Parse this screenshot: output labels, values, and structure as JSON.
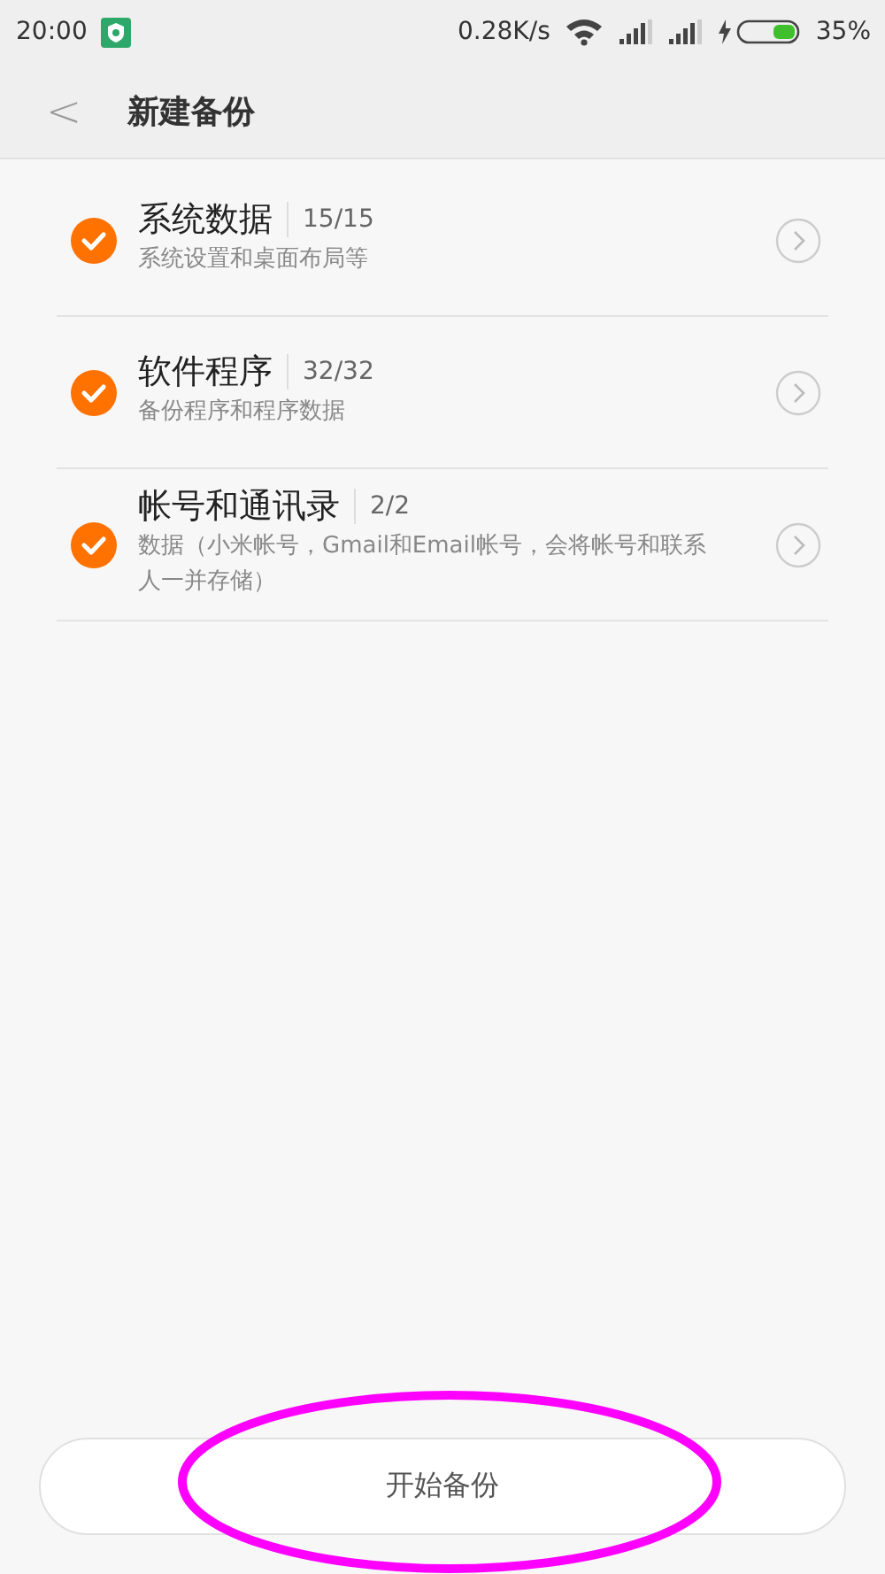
{
  "status_bar": {
    "time": "20:00",
    "speed": "0.28K/s",
    "battery": "35%"
  },
  "header": {
    "back": "<",
    "title": "新建备份"
  },
  "items": [
    {
      "title": "系统数据",
      "count": "15/15",
      "description": "系统设置和桌面布局等",
      "checked": true
    },
    {
      "title": "软件程序",
      "count": "32/32",
      "description": "备份程序和程序数据",
      "checked": true
    },
    {
      "title": "帐号和通讯录",
      "count": "2/2",
      "description": "数据（小米帐号，Gmail和Email帐号，会将帐号和联系人一并存储）",
      "checked": true
    }
  ],
  "start_button": {
    "label": "开始备份"
  }
}
